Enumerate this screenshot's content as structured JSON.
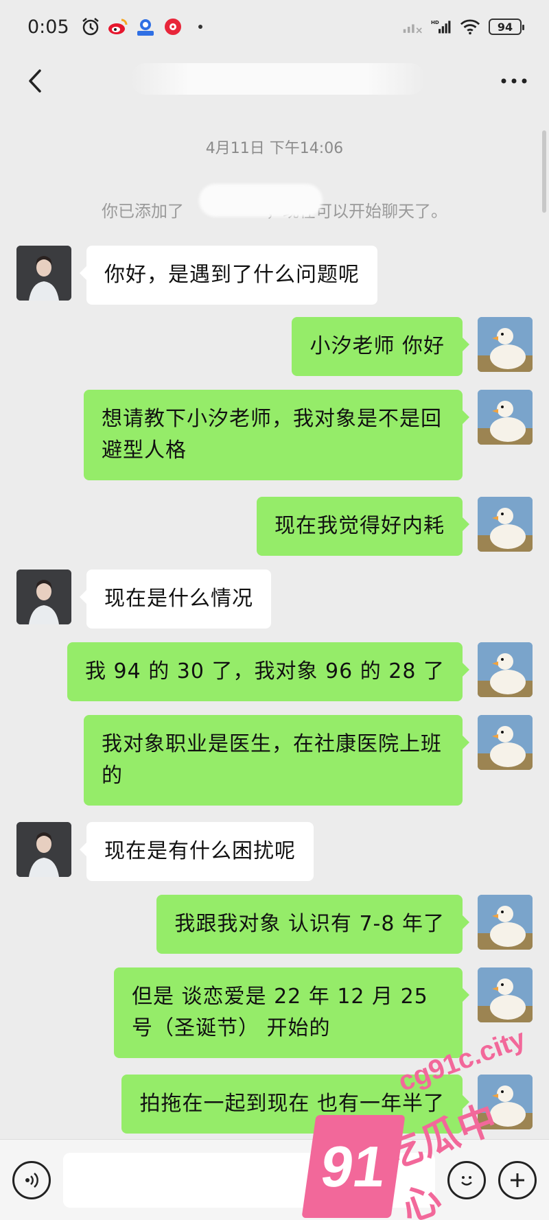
{
  "status_bar": {
    "time": "0:05",
    "network": "HD",
    "battery": "94"
  },
  "nav": {
    "title": ""
  },
  "chat": {
    "timestamp": "4月11日 下午14:06",
    "system_message": "你已添加了　　　　　，现在可以开始聊天了。",
    "messages": [
      {
        "side": "left",
        "text": "你好，是遇到了什么问题呢"
      },
      {
        "side": "right",
        "text": "小汐老师 你好"
      },
      {
        "side": "right",
        "text": "想请教下小汐老师，我对象是不是回避型人格"
      },
      {
        "side": "right",
        "text": "现在我觉得好内耗"
      },
      {
        "side": "left",
        "text": "现在是什么情况"
      },
      {
        "side": "right",
        "text": "我 94 的 30 了，我对象 96 的 28 了"
      },
      {
        "side": "right",
        "text": "我对象职业是医生，在社康医院上班的"
      },
      {
        "side": "left",
        "text": "现在是有什么困扰呢"
      },
      {
        "side": "right",
        "text": "我跟我对象 认识有 7-8 年了"
      },
      {
        "side": "right",
        "text": "但是 谈恋爱是 22 年 12 月 25 号（圣诞节） 开始的"
      },
      {
        "side": "right",
        "text": "拍拖在一起到现在 也有一年半了"
      }
    ]
  },
  "input_bar": {
    "placeholder": ""
  },
  "watermark": {
    "badge": "91",
    "domain": "cg91c.city",
    "name": "吃瓜中心"
  },
  "colors": {
    "background": "#ececec",
    "bubble_right": "#95ec69",
    "bubble_left": "#ffffff",
    "watermark": "#f2689a"
  }
}
